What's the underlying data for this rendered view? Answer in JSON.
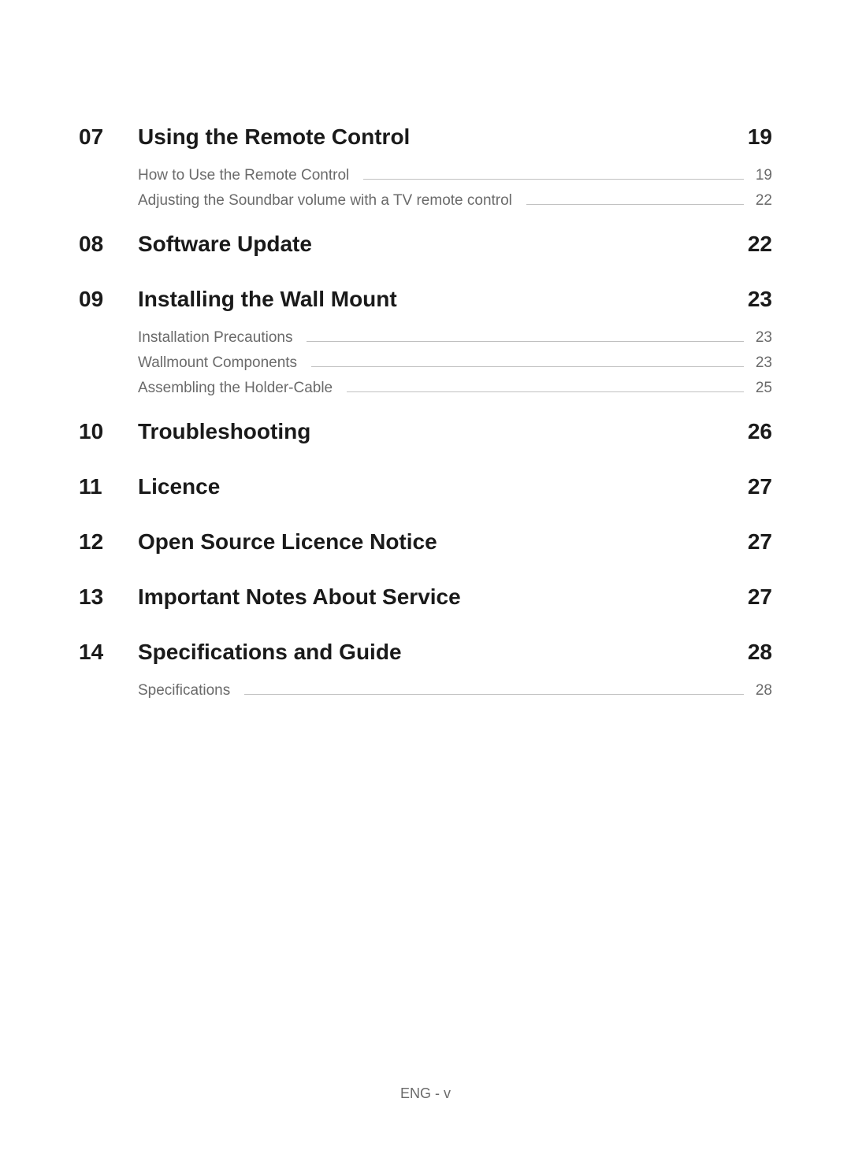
{
  "sections": [
    {
      "number": "07",
      "title": "Using the Remote Control",
      "page": "19",
      "subs": [
        {
          "title": "How to Use the Remote Control",
          "page": "19"
        },
        {
          "title": "Adjusting the Soundbar volume with a TV remote control",
          "page": "22"
        }
      ]
    },
    {
      "number": "08",
      "title": "Software Update",
      "page": "22",
      "subs": []
    },
    {
      "number": "09",
      "title": "Installing the Wall Mount",
      "page": "23",
      "subs": [
        {
          "title": "Installation Precautions",
          "page": "23"
        },
        {
          "title": "Wallmount Components",
          "page": "23"
        },
        {
          "title": "Assembling the Holder-Cable",
          "page": "25"
        }
      ]
    },
    {
      "number": "10",
      "title": "Troubleshooting",
      "page": "26",
      "subs": []
    },
    {
      "number": "11",
      "title": "Licence",
      "page": "27",
      "subs": []
    },
    {
      "number": "12",
      "title": "Open Source Licence Notice",
      "page": "27",
      "subs": []
    },
    {
      "number": "13",
      "title": "Important Notes About Service",
      "page": "27",
      "subs": []
    },
    {
      "number": "14",
      "title": "Specifications and Guide",
      "page": "28",
      "subs": [
        {
          "title": "Specifications",
          "page": "28"
        }
      ]
    }
  ],
  "footer": "ENG - v"
}
